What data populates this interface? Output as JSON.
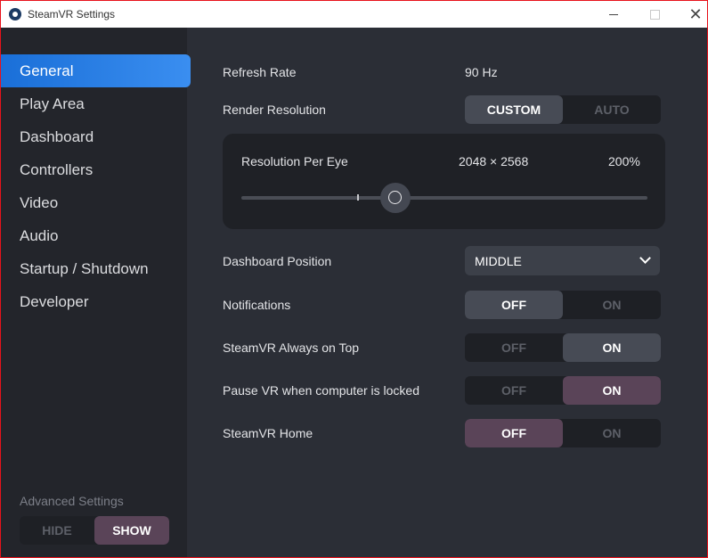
{
  "window": {
    "title": "SteamVR Settings",
    "close_glyph": "✕"
  },
  "sidebar": {
    "items": [
      {
        "label": "General",
        "active": true
      },
      {
        "label": "Play Area",
        "active": false
      },
      {
        "label": "Dashboard",
        "active": false
      },
      {
        "label": "Controllers",
        "active": false
      },
      {
        "label": "Video",
        "active": false
      },
      {
        "label": "Audio",
        "active": false
      },
      {
        "label": "Startup / Shutdown",
        "active": false
      },
      {
        "label": "Developer",
        "active": false
      }
    ],
    "advanced": {
      "label": "Advanced Settings",
      "hide": "HIDE",
      "show": "SHOW",
      "selected": "SHOW"
    }
  },
  "general": {
    "refresh_rate": {
      "label": "Refresh Rate",
      "value": "90 Hz"
    },
    "render_resolution": {
      "label": "Render Resolution",
      "custom": "CUSTOM",
      "auto": "AUTO",
      "selected": "CUSTOM"
    },
    "resolution_per_eye": {
      "label": "Resolution Per Eye",
      "value": "2048 × 2568",
      "percent": "200%",
      "slider_level": 0.38
    },
    "dashboard_position": {
      "label": "Dashboard Position",
      "value": "MIDDLE"
    },
    "notifications": {
      "label": "Notifications",
      "off": "OFF",
      "on": "ON",
      "selected": "OFF"
    },
    "always_on_top": {
      "label": "SteamVR Always on Top",
      "off": "OFF",
      "on": "ON",
      "selected": "ON"
    },
    "pause_locked": {
      "label": "Pause VR when computer is locked",
      "off": "OFF",
      "on": "ON",
      "selected": "ON"
    },
    "steamvr_home": {
      "label": "SteamVR Home",
      "off": "OFF",
      "on": "ON",
      "selected": "OFF"
    }
  },
  "colors": {
    "accent": "#2a7fe5",
    "window_border": "#e8121b",
    "toggle_grey": "#474b55",
    "toggle_purple": "#5a4458"
  }
}
